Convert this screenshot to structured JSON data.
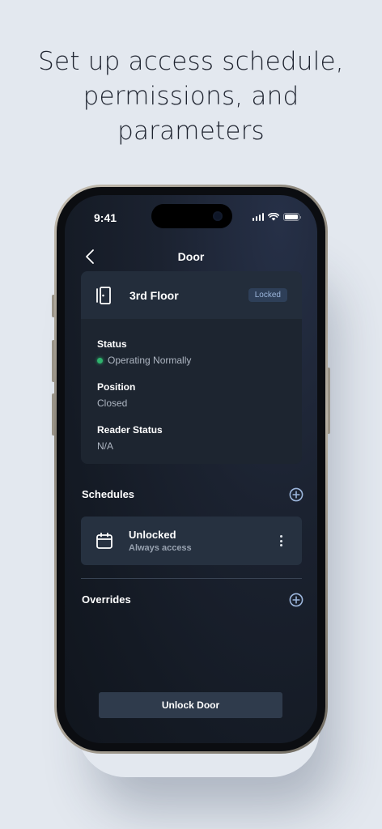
{
  "headline": {
    "line1": "Set up access schedule,",
    "line2": "permissions, and",
    "line3": "parameters"
  },
  "status_bar": {
    "time": "9:41"
  },
  "nav": {
    "title": "Door"
  },
  "door": {
    "name": "3rd Floor",
    "lock_badge": "Locked",
    "fields": [
      {
        "label": "Status",
        "value": "Operating Normally",
        "indicator_color": "#2fb36d"
      },
      {
        "label": "Position",
        "value": "Closed"
      },
      {
        "label": "Reader Status",
        "value": "N/A"
      }
    ]
  },
  "schedules": {
    "title": "Schedules",
    "items": [
      {
        "title": "Unlocked",
        "subtitle": "Always access"
      }
    ]
  },
  "overrides": {
    "title": "Overrides"
  },
  "primary_action": {
    "label": "Unlock Door"
  },
  "colors": {
    "accent": "#9cb6dc",
    "background": "#e3e8ef",
    "screen": "#1b2230",
    "status_ok": "#2fb36d"
  }
}
